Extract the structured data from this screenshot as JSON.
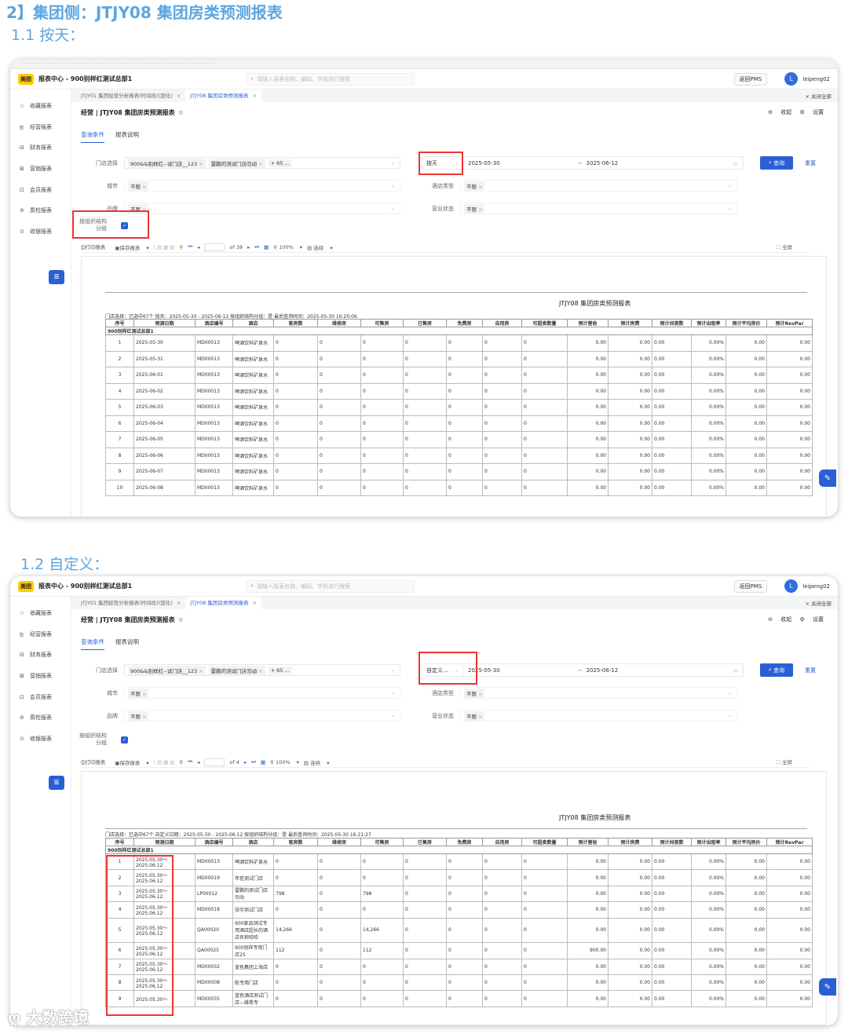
{
  "doc": {
    "heading": "2】集团侧：JTJY08 集团房类预测报表",
    "sec1": "1.1  按天：",
    "sec2": "1.2  自定义："
  },
  "app": {
    "logo": "美团",
    "title": "报表中心 - 900别样红测试总部1",
    "search_placeholder": "请输入报表名称、编码、字段进行搜索",
    "pms_btn": "返回PMS",
    "avatar": "L",
    "user": "leipeng02"
  },
  "sidebar": [
    "收藏报表",
    "经营报表",
    "财务报表",
    "营销报表",
    "会员报表",
    "质检报表",
    "收银报表"
  ],
  "tabs": {
    "t1": "JTJY01 集团经营分析报表(时间段)(固化)",
    "t2": "JTJY08 集团房类预测报表",
    "close_all": "关闭全部"
  },
  "report": {
    "title": "经营 | JTJY08 集团房类预测报表",
    "collapse": "收起",
    "settings": "设置",
    "tab_query": "查询条件",
    "tab_desc": "报表说明"
  },
  "filters": {
    "store_label": "门店选择",
    "store_tag1": "900&&别样红--试门店__123",
    "store_tag2": "雷鹏的测试门店勿动",
    "store_more": "+ 65 ...",
    "city_label": "城市",
    "brand_label": "品牌",
    "none": "不限",
    "hotel_type_label": "酒店类型",
    "status_label": "营业状态",
    "org_label_1": "按组织结构",
    "org_label_2": "分组",
    "query_btn": "查询",
    "reset_btn": "重置",
    "date_start": "2025-05-30",
    "date_end": "2025-06-12"
  },
  "shot1": {
    "date_mode": "按天",
    "pages": "of 38"
  },
  "shot2": {
    "date_mode": "自定义...",
    "pages": "of 4"
  },
  "toolbar": {
    "print": "打印报表",
    "save": "保存报表",
    "zoom": "100%",
    "continuous": "连续",
    "fullscreen": "全屏"
  },
  "table": {
    "report_title": "JTJY08 集团房类预测报表",
    "meta1": "门店选择：已选中67个      按天：2025-05-30 - 2025-06-12      按组织结构分组：是      最后查询时间：2025-05-30 16:20:06",
    "meta2": "门店选择：已选中67个      自定义日期：2025-05-30 - 2025-06-12      按组织结构分组：是      最后查询时间：2025-05-30 16:21:27",
    "headers": [
      "序号",
      "预测日期",
      "酒店编号",
      "酒店",
      "客房数",
      "维修房",
      "可售房",
      "已售房",
      "免费房",
      "自用房",
      "可超卖数量",
      "预计营收",
      "预计房费",
      "预计间夜数",
      "预计出租率",
      "预计平均房价",
      "预计RevPar"
    ],
    "group": "900别样红测试总部1",
    "rows1": [
      [
        "1",
        "2025-05-30",
        "MD00013",
        "啤酒饮料矿泉水",
        "0",
        "0",
        "0",
        "0",
        "0",
        "0",
        "0",
        "0.00",
        "0.00",
        "0.00",
        "0.00%",
        "0.00",
        "0.00"
      ],
      [
        "2",
        "2025-05-31",
        "MD00013",
        "啤酒饮料矿泉水",
        "0",
        "0",
        "0",
        "0",
        "0",
        "0",
        "0",
        "0.00",
        "0.00",
        "0.00",
        "0.00%",
        "0.00",
        "0.00"
      ],
      [
        "3",
        "2025-06-01",
        "MD00013",
        "啤酒饮料矿泉水",
        "0",
        "0",
        "0",
        "0",
        "0",
        "0",
        "0",
        "0.00",
        "0.00",
        "0.00",
        "0.00%",
        "0.00",
        "0.00"
      ],
      [
        "4",
        "2025-06-02",
        "MD00013",
        "啤酒饮料矿泉水",
        "0",
        "0",
        "0",
        "0",
        "0",
        "0",
        "0",
        "0.00",
        "0.00",
        "0.00",
        "0.00%",
        "0.00",
        "0.00"
      ],
      [
        "5",
        "2025-06-03",
        "MD00013",
        "啤酒饮料矿泉水",
        "0",
        "0",
        "0",
        "0",
        "0",
        "0",
        "0",
        "0.00",
        "0.00",
        "0.00",
        "0.00%",
        "0.00",
        "0.00"
      ],
      [
        "6",
        "2025-06-04",
        "MD00013",
        "啤酒饮料矿泉水",
        "0",
        "0",
        "0",
        "0",
        "0",
        "0",
        "0",
        "0.00",
        "0.00",
        "0.00",
        "0.00%",
        "0.00",
        "0.00"
      ],
      [
        "7",
        "2025-06-05",
        "MD00013",
        "啤酒饮料矿泉水",
        "0",
        "0",
        "0",
        "0",
        "0",
        "0",
        "0",
        "0.00",
        "0.00",
        "0.00",
        "0.00%",
        "0.00",
        "0.00"
      ],
      [
        "8",
        "2025-06-06",
        "MD00013",
        "啤酒饮料矿泉水",
        "0",
        "0",
        "0",
        "0",
        "0",
        "0",
        "0",
        "0.00",
        "0.00",
        "0.00",
        "0.00%",
        "0.00",
        "0.00"
      ],
      [
        "9",
        "2025-06-07",
        "MD00013",
        "啤酒饮料矿泉水",
        "0",
        "0",
        "0",
        "0",
        "0",
        "0",
        "0",
        "0.00",
        "0.00",
        "0.00",
        "0.00%",
        "0.00",
        "0.00"
      ],
      [
        "10",
        "2025-06-08",
        "MD00013",
        "啤酒饮料矿泉水",
        "0",
        "0",
        "0",
        "0",
        "0",
        "0",
        "0",
        "0.00",
        "0.00",
        "0.00",
        "0.00%",
        "0.00",
        "0.00"
      ]
    ],
    "rows2": [
      [
        "1",
        "2025.05.30～2025.06.12",
        "MD00013",
        "啤酒饮料矿泉水",
        "0",
        "0",
        "0",
        "0",
        "0",
        "0",
        "0",
        "0.00",
        "0.00",
        "0.00",
        "0.00%",
        "0.00",
        "0.00"
      ],
      [
        "2",
        "2025.05.30～2025.06.12",
        "MD00019",
        "年茬测试门店",
        "0",
        "0",
        "0",
        "0",
        "0",
        "0",
        "0",
        "0.00",
        "0.00",
        "0.00",
        "0.00%",
        "0.00",
        "0.00"
      ],
      [
        "3",
        "2025.05.30～2025.06.12",
        "LP00012",
        "雷鹏的测试门店勿动",
        "798",
        "0",
        "798",
        "0",
        "0",
        "0",
        "0",
        "0.00",
        "0.00",
        "0.00",
        "0.00%",
        "0.00",
        "0.00"
      ],
      [
        "4",
        "2025.05.30～2025.06.12",
        "MD00018",
        "张宇测试门店",
        "0",
        "0",
        "0",
        "0",
        "0",
        "0",
        "0",
        "0.00",
        "0.00",
        "0.00",
        "0.00%",
        "0.00",
        "0.00"
      ],
      [
        "5",
        "2025.05.30～2025.06.12",
        "QA00020",
        "900家品测试专用酒店超长的酒店名称哈哈",
        "14,266",
        "0",
        "14,266",
        "0",
        "0",
        "0",
        "0",
        "0.00",
        "0.00",
        "0.00",
        "0.00%",
        "0.00",
        "0.00"
      ],
      [
        "6",
        "2025.05.30～2025.06.12",
        "QA00025",
        "900别样专用门店25",
        "112",
        "0",
        "112",
        "0",
        "0",
        "0",
        "0",
        "900.00",
        "0.00",
        "0.00",
        "0.00%",
        "0.00",
        "0.00"
      ],
      [
        "7",
        "2025.05.30～2025.06.12",
        "MD00032",
        "蓝色集团上海店",
        "0",
        "0",
        "0",
        "0",
        "0",
        "0",
        "0",
        "0.00",
        "0.00",
        "0.00",
        "0.00%",
        "0.00",
        "0.00"
      ],
      [
        "8",
        "2025.05.30～2025.06.12",
        "MD00008",
        "陈专用门店",
        "0",
        "0",
        "0",
        "0",
        "0",
        "0",
        "0",
        "0.00",
        "0.00",
        "0.00",
        "0.00%",
        "0.00",
        "0.00"
      ],
      [
        "9",
        "2025.05.30～",
        "MD00035",
        "蓝色酒店测试门店—维希专",
        "0",
        "0",
        "0",
        "0",
        "0",
        "0",
        "0",
        "0.00",
        "0.00",
        "0.00",
        "0.00%",
        "0.00",
        "0.00"
      ]
    ]
  },
  "watermark": "大数跨境"
}
